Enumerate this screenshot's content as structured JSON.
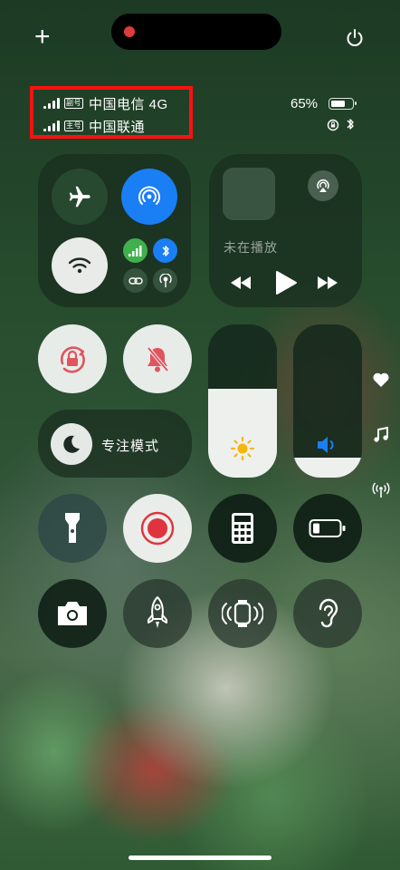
{
  "top": {
    "add_label": "+"
  },
  "status": {
    "carrier1_tag": "副号",
    "carrier1_name": "中国电信 4G",
    "carrier2_tag": "主号",
    "carrier2_name": "中国联通",
    "battery_pct": "65%",
    "battery_level": 0.65
  },
  "media": {
    "label": "未在播放"
  },
  "focus": {
    "label": "专注模式"
  },
  "levels": {
    "brightness": 0.58,
    "volume": 0.13
  },
  "colors": {
    "accent_blue": "#1a7ef5",
    "cellular_green": "#3fb04b",
    "mute_red": "#e0545d",
    "annotation_red": "#ff1010"
  }
}
